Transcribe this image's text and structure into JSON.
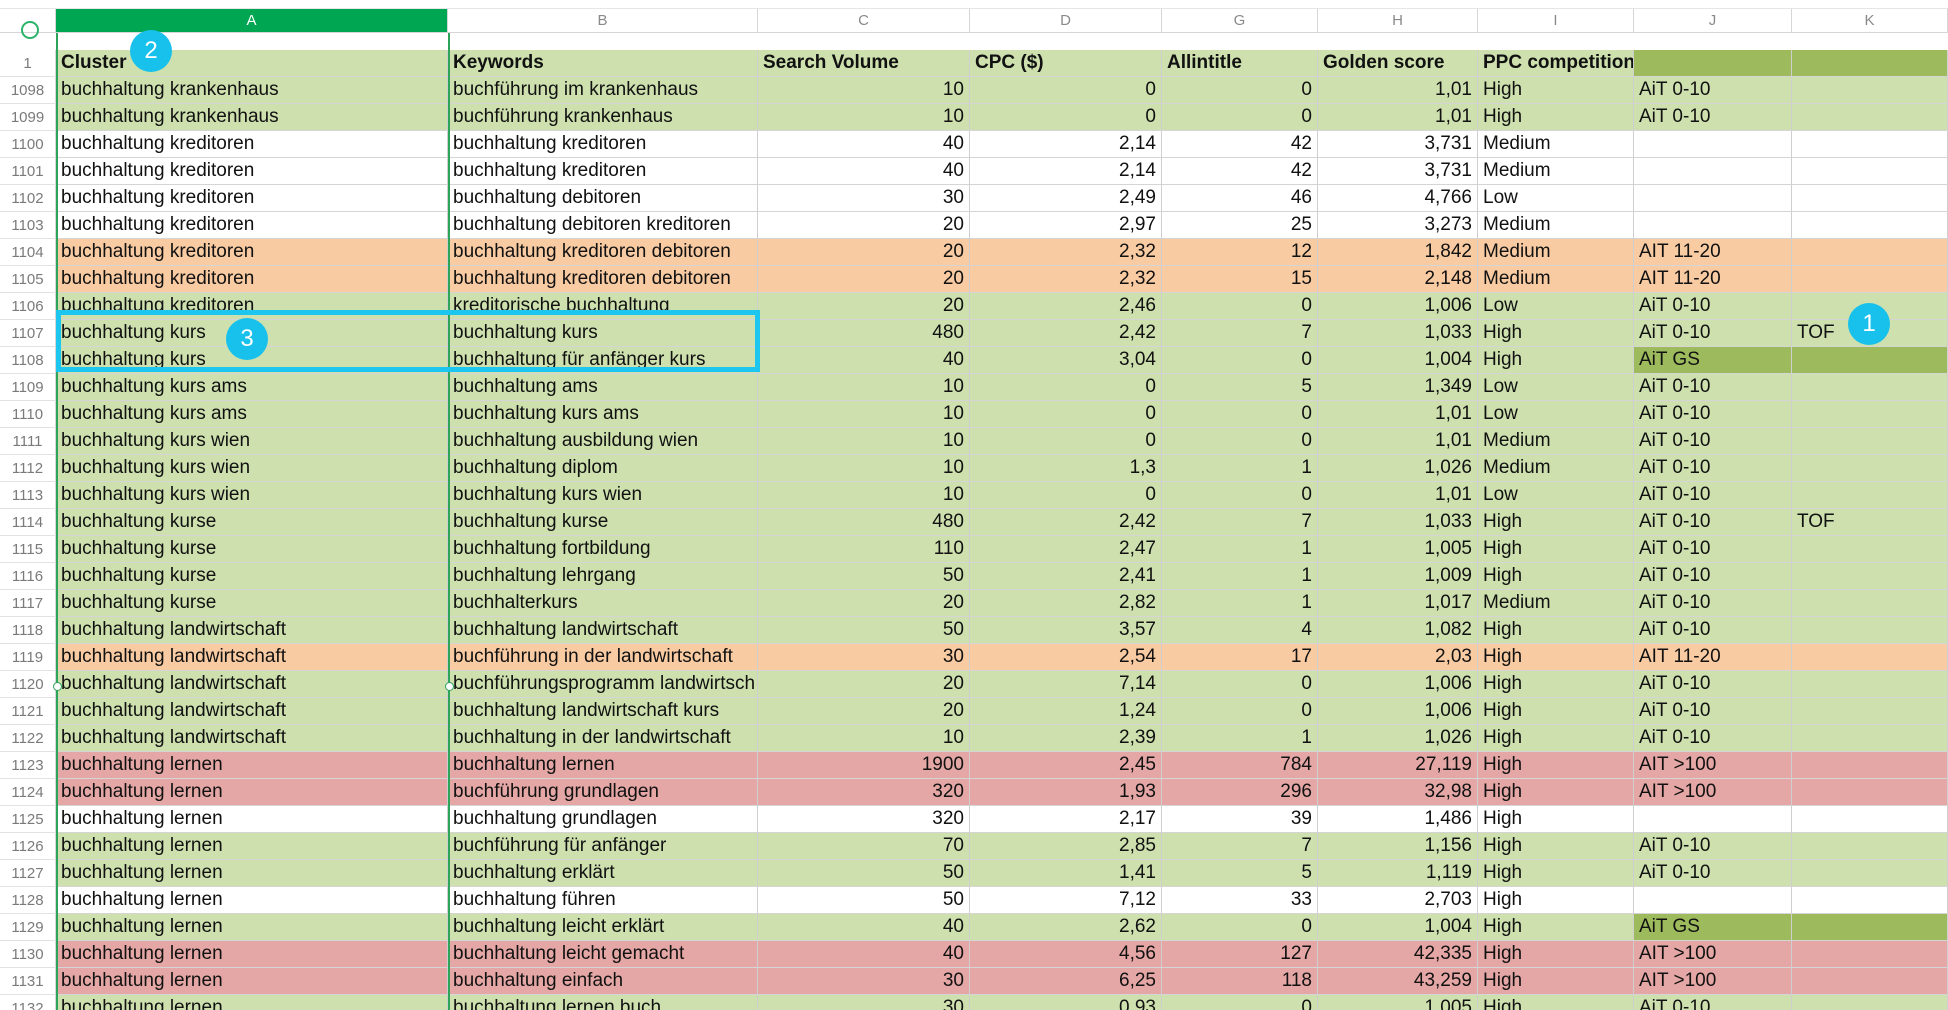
{
  "columns": [
    {
      "letter": "A",
      "selected": true
    },
    {
      "letter": "B",
      "selected": false
    },
    {
      "letter": "C",
      "selected": false
    },
    {
      "letter": "D",
      "selected": false
    },
    {
      "letter": "G",
      "selected": false
    },
    {
      "letter": "H",
      "selected": false
    },
    {
      "letter": "I",
      "selected": false
    },
    {
      "letter": "J",
      "selected": false
    },
    {
      "letter": "K",
      "selected": false
    }
  ],
  "header": {
    "row_number": "1",
    "cells": [
      "Cluster",
      "Keywords",
      "Search Volume",
      "CPC ($)",
      "Allintitle",
      "Golden score",
      "PPC competition",
      "",
      ""
    ]
  },
  "colors": {
    "green": "#cde0ae",
    "white": "#ffffff",
    "orange": "#f9cba2",
    "red": "#e4a7a5",
    "dark_green": "#9dbb5d",
    "selected_col": "#00a651",
    "annotation": "#17c1ec"
  },
  "annotations": [
    "1",
    "2",
    "3"
  ],
  "rows": [
    {
      "n": "1098",
      "c": [
        "buchhaltung krankenhaus",
        "buchführung im krankenhaus",
        "10",
        "0",
        "0",
        "1,01",
        "High",
        "AiT 0-10",
        ""
      ],
      "bg": "green"
    },
    {
      "n": "1099",
      "c": [
        "buchhaltung krankenhaus",
        "buchführung krankenhaus",
        "10",
        "0",
        "0",
        "1,01",
        "High",
        "AiT 0-10",
        ""
      ],
      "bg": "green"
    },
    {
      "n": "1100",
      "c": [
        "buchhaltung kreditoren",
        "buchhaltung kreditoren",
        "40",
        "2,14",
        "42",
        "3,731",
        "Medium",
        "",
        ""
      ],
      "bg": "white"
    },
    {
      "n": "1101",
      "c": [
        "buchhaltung kreditoren",
        "buchhaltung kreditoren",
        "40",
        "2,14",
        "42",
        "3,731",
        "Medium",
        "",
        ""
      ],
      "bg": "white"
    },
    {
      "n": "1102",
      "c": [
        "buchhaltung kreditoren",
        "buchhaltung debitoren",
        "30",
        "2,49",
        "46",
        "4,766",
        "Low",
        "",
        ""
      ],
      "bg": "white"
    },
    {
      "n": "1103",
      "c": [
        "buchhaltung kreditoren",
        "buchhaltung debitoren kreditoren",
        "20",
        "2,97",
        "25",
        "3,273",
        "Medium",
        "",
        ""
      ],
      "bg": "white"
    },
    {
      "n": "1104",
      "c": [
        "buchhaltung kreditoren",
        "buchhaltung kreditoren debitoren",
        "20",
        "2,32",
        "12",
        "1,842",
        "Medium",
        "AIT 11-20",
        ""
      ],
      "bg": "orange"
    },
    {
      "n": "1105",
      "c": [
        "buchhaltung kreditoren",
        "buchhaltung kreditoren debitoren",
        "20",
        "2,32",
        "15",
        "2,148",
        "Medium",
        "AIT 11-20",
        ""
      ],
      "bg": "orange"
    },
    {
      "n": "1106",
      "c": [
        "buchhaltung kreditoren",
        "kreditorische buchhaltung",
        "20",
        "2,46",
        "0",
        "1,006",
        "Low",
        "AiT 0-10",
        ""
      ],
      "bg": "green"
    },
    {
      "n": "1107",
      "c": [
        "buchhaltung kurs",
        "buchhaltung kurs",
        "480",
        "2,42",
        "7",
        "1,033",
        "High",
        "AiT 0-10",
        "TOF"
      ],
      "bg": "green"
    },
    {
      "n": "1108",
      "c": [
        "buchhaltung kurs",
        "buchhaltung für anfänger kurs",
        "40",
        "3,04",
        "0",
        "1,004",
        "High",
        "AiT GS",
        ""
      ],
      "bg": "green",
      "jk": "dark_green"
    },
    {
      "n": "1109",
      "c": [
        "buchhaltung kurs ams",
        "buchhaltung ams",
        "10",
        "0",
        "5",
        "1,349",
        "Low",
        "AiT 0-10",
        ""
      ],
      "bg": "green"
    },
    {
      "n": "1110",
      "c": [
        "buchhaltung kurs ams",
        "buchhaltung kurs ams",
        "10",
        "0",
        "0",
        "1,01",
        "Low",
        "AiT 0-10",
        ""
      ],
      "bg": "green"
    },
    {
      "n": "1111",
      "c": [
        "buchhaltung kurs wien",
        "buchhaltung ausbildung wien",
        "10",
        "0",
        "0",
        "1,01",
        "Medium",
        "AiT 0-10",
        ""
      ],
      "bg": "green"
    },
    {
      "n": "1112",
      "c": [
        "buchhaltung kurs wien",
        "buchhaltung diplom",
        "10",
        "1,3",
        "1",
        "1,026",
        "Medium",
        "AiT 0-10",
        ""
      ],
      "bg": "green"
    },
    {
      "n": "1113",
      "c": [
        "buchhaltung kurs wien",
        "buchhaltung kurs wien",
        "10",
        "0",
        "0",
        "1,01",
        "Low",
        "AiT 0-10",
        ""
      ],
      "bg": "green"
    },
    {
      "n": "1114",
      "c": [
        "buchhaltung kurse",
        "buchhaltung kurse",
        "480",
        "2,42",
        "7",
        "1,033",
        "High",
        "AiT 0-10",
        "TOF"
      ],
      "bg": "green"
    },
    {
      "n": "1115",
      "c": [
        "buchhaltung kurse",
        "buchhaltung fortbildung",
        "110",
        "2,47",
        "1",
        "1,005",
        "High",
        "AiT 0-10",
        ""
      ],
      "bg": "green"
    },
    {
      "n": "1116",
      "c": [
        "buchhaltung kurse",
        "buchhaltung lehrgang",
        "50",
        "2,41",
        "1",
        "1,009",
        "High",
        "AiT 0-10",
        ""
      ],
      "bg": "green"
    },
    {
      "n": "1117",
      "c": [
        "buchhaltung kurse",
        "buchhalterkurs",
        "20",
        "2,82",
        "1",
        "1,017",
        "Medium",
        "AiT 0-10",
        ""
      ],
      "bg": "green"
    },
    {
      "n": "1118",
      "c": [
        "buchhaltung landwirtschaft",
        "buchhaltung landwirtschaft",
        "50",
        "3,57",
        "4",
        "1,082",
        "High",
        "AiT 0-10",
        ""
      ],
      "bg": "green"
    },
    {
      "n": "1119",
      "c": [
        "buchhaltung landwirtschaft",
        "buchführung in der landwirtschaft",
        "30",
        "2,54",
        "17",
        "2,03",
        "High",
        "AIT 11-20",
        ""
      ],
      "bg": "orange"
    },
    {
      "n": "1120",
      "c": [
        "buchhaltung landwirtschaft",
        "buchführungsprogramm landwirtsch",
        "20",
        "7,14",
        "0",
        "1,006",
        "High",
        "AiT 0-10",
        ""
      ],
      "bg": "green"
    },
    {
      "n": "1121",
      "c": [
        "buchhaltung landwirtschaft",
        "buchhaltung landwirtschaft kurs",
        "20",
        "1,24",
        "0",
        "1,006",
        "High",
        "AiT 0-10",
        ""
      ],
      "bg": "green"
    },
    {
      "n": "1122",
      "c": [
        "buchhaltung landwirtschaft",
        "buchhaltung in der landwirtschaft",
        "10",
        "2,39",
        "1",
        "1,026",
        "High",
        "AiT 0-10",
        ""
      ],
      "bg": "green"
    },
    {
      "n": "1123",
      "c": [
        "buchhaltung lernen",
        "buchhaltung lernen",
        "1900",
        "2,45",
        "784",
        "27,119",
        "High",
        "AIT >100",
        ""
      ],
      "bg": "red"
    },
    {
      "n": "1124",
      "c": [
        "buchhaltung lernen",
        "buchführung grundlagen",
        "320",
        "1,93",
        "296",
        "32,98",
        "High",
        "AIT >100",
        ""
      ],
      "bg": "red"
    },
    {
      "n": "1125",
      "c": [
        "buchhaltung lernen",
        "buchhaltung grundlagen",
        "320",
        "2,17",
        "39",
        "1,486",
        "High",
        "",
        ""
      ],
      "bg": "white"
    },
    {
      "n": "1126",
      "c": [
        "buchhaltung lernen",
        "buchführung für anfänger",
        "70",
        "2,85",
        "7",
        "1,156",
        "High",
        "AiT 0-10",
        ""
      ],
      "bg": "green"
    },
    {
      "n": "1127",
      "c": [
        "buchhaltung lernen",
        "buchhaltung erklärt",
        "50",
        "1,41",
        "5",
        "1,119",
        "High",
        "AiT 0-10",
        ""
      ],
      "bg": "green"
    },
    {
      "n": "1128",
      "c": [
        "buchhaltung lernen",
        "buchhaltung führen",
        "50",
        "7,12",
        "33",
        "2,703",
        "High",
        "",
        ""
      ],
      "bg": "white"
    },
    {
      "n": "1129",
      "c": [
        "buchhaltung lernen",
        "buchhaltung leicht erklärt",
        "40",
        "2,62",
        "0",
        "1,004",
        "High",
        "AiT GS",
        ""
      ],
      "bg": "green",
      "jk": "dark_green"
    },
    {
      "n": "1130",
      "c": [
        "buchhaltung lernen",
        "buchhaltung leicht gemacht",
        "40",
        "4,56",
        "127",
        "42,335",
        "High",
        "AIT >100",
        ""
      ],
      "bg": "red"
    },
    {
      "n": "1131",
      "c": [
        "buchhaltung lernen",
        "buchhaltung einfach",
        "30",
        "6,25",
        "118",
        "43,259",
        "High",
        "AIT >100",
        ""
      ],
      "bg": "red"
    },
    {
      "n": "1132",
      "c": [
        "buchhaltung lernen",
        "buchhaltung lernen buch",
        "30",
        "0,93",
        "0",
        "1,005",
        "High",
        "AiT 0-10",
        ""
      ],
      "bg": "green"
    }
  ]
}
